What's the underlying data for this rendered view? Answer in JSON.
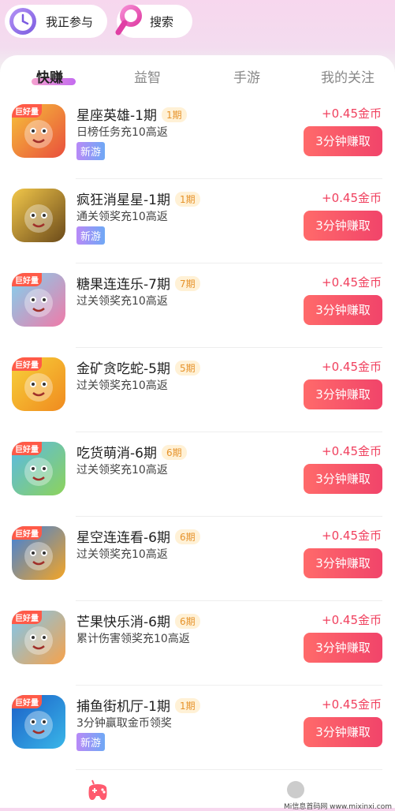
{
  "header": {
    "participating_label": "我正参与",
    "search_label": "搜索",
    "icons": {
      "participating": "clock-icon",
      "search": "search-icon"
    }
  },
  "tabs": [
    {
      "label": "快赚",
      "active": true
    },
    {
      "label": "益智",
      "active": false
    },
    {
      "label": "手游",
      "active": false
    },
    {
      "label": "我的关注",
      "active": false
    }
  ],
  "games": [
    {
      "title": "星座英雄-1期",
      "period": "1期",
      "desc": "日榜任务充10高返",
      "tag": "新游",
      "hot": "巨好量",
      "reward": "+0.45金币",
      "button": "3分钟赚取",
      "colors": [
        "#f6c33a",
        "#e94e3c"
      ]
    },
    {
      "title": "疯狂消星星-1期",
      "period": "1期",
      "desc": "通关领奖充10高返",
      "tag": "新游",
      "hot": "",
      "reward": "+0.45金币",
      "button": "3分钟赚取",
      "colors": [
        "#f2c74a",
        "#6b4a1a"
      ]
    },
    {
      "title": "糖果连连乐-7期",
      "period": "7期",
      "desc": "过关领奖充10高返",
      "tag": "",
      "hot": "巨好量",
      "reward": "+0.45金币",
      "button": "3分钟赚取",
      "colors": [
        "#7ed3f0",
        "#f07aa8"
      ]
    },
    {
      "title": "金矿贪吃蛇-5期",
      "period": "5期",
      "desc": "过关领奖充10高返",
      "tag": "",
      "hot": "巨好量",
      "reward": "+0.45金币",
      "button": "3分钟赚取",
      "colors": [
        "#f7d23a",
        "#f08a1f"
      ]
    },
    {
      "title": "吃货萌消-6期",
      "period": "6期",
      "desc": "过关领奖充10高返",
      "tag": "",
      "hot": "巨好量",
      "reward": "+0.45金币",
      "button": "3分钟赚取",
      "colors": [
        "#58b9e8",
        "#8dd35a"
      ]
    },
    {
      "title": "星空连连看-6期",
      "period": "6期",
      "desc": "过关领奖充10高返",
      "tag": "",
      "hot": "巨好量",
      "reward": "+0.45金币",
      "button": "3分钟赚取",
      "colors": [
        "#3a7fe0",
        "#f5a524"
      ]
    },
    {
      "title": "芒果快乐消-6期",
      "period": "6期",
      "desc": "累计伤害领奖充10高返",
      "tag": "",
      "hot": "巨好量",
      "reward": "+0.45金币",
      "button": "3分钟赚取",
      "colors": [
        "#7cc8f2",
        "#f7a24a"
      ]
    },
    {
      "title": "捕鱼街机厅-1期",
      "period": "1期",
      "desc": "3分钟赢取金币领奖",
      "tag": "新游",
      "hot": "巨好量",
      "reward": "+0.45金币",
      "button": "3分钟赚取",
      "colors": [
        "#1b5fc8",
        "#39b6e8"
      ]
    }
  ],
  "bottom_nav": {
    "icons": [
      "gamepad-icon",
      "profile-icon"
    ]
  },
  "watermark": "Mi信息首码网 www.mixinxi.com",
  "colors": {
    "accent": "#f0405e",
    "button_from": "#ff6a6a",
    "button_to": "#f1446a",
    "tab_underline_from": "#f5a0cf",
    "tab_underline_to": "#c46bf0"
  }
}
